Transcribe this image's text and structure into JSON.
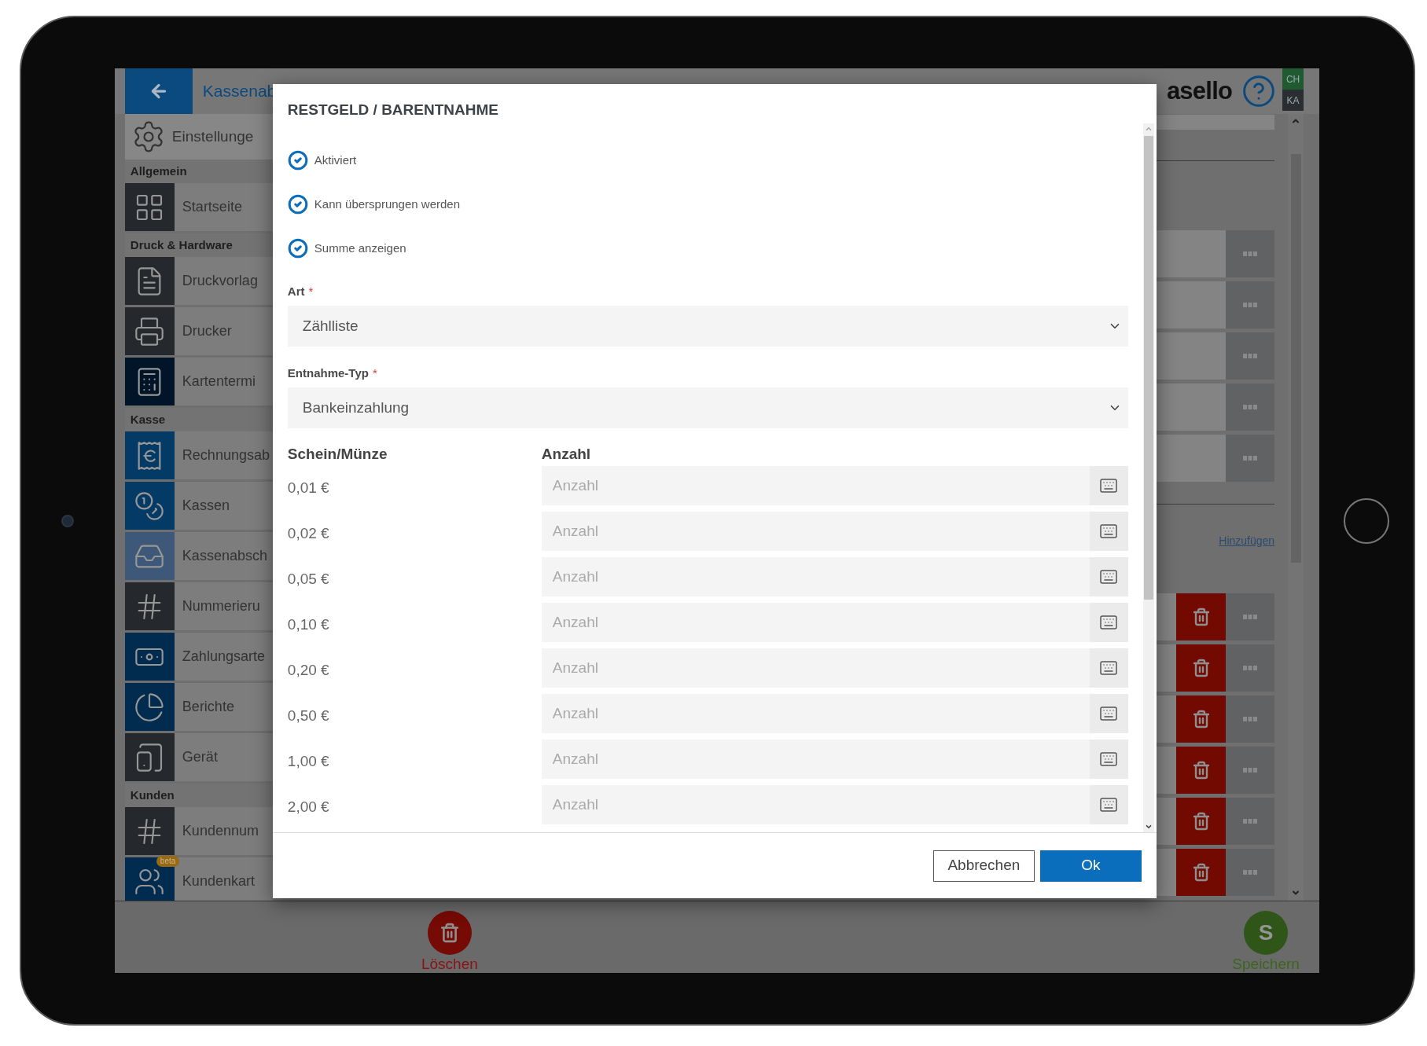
{
  "header": {
    "title": "Kassenab",
    "logo": "asello",
    "badges": [
      {
        "label": "CH",
        "color": "#1f5a30"
      },
      {
        "label": "KA",
        "color": "#2a2d31"
      }
    ]
  },
  "sidebar": {
    "header": "Einstellunge",
    "sections": [
      {
        "title": "Allgemein",
        "items": [
          {
            "label": "Startseite",
            "color": "#25282c"
          }
        ]
      },
      {
        "title": "Druck & Hardware",
        "items": [
          {
            "label": "Druckvorlag",
            "color": "#25282c"
          },
          {
            "label": "Drucker",
            "color": "#25282c"
          },
          {
            "label": "Kartentermi",
            "color": "#011528"
          }
        ]
      },
      {
        "title": "Kasse",
        "items": [
          {
            "label": "Rechnungsab",
            "color": "#033a66"
          },
          {
            "label": "Kassen",
            "color": "#033a66"
          },
          {
            "label": "Kassenabsch",
            "color": "#3d5878"
          },
          {
            "label": "Nummerieru",
            "color": "#25282c"
          },
          {
            "label": "Zahlungsarte",
            "color": "#022b50"
          },
          {
            "label": "Berichte",
            "color": "#022b50"
          },
          {
            "label": "Gerät",
            "color": "#25282c"
          }
        ]
      },
      {
        "title": "Kunden",
        "items": [
          {
            "label": "Kundennum",
            "color": "#25282c"
          },
          {
            "label": "Kundenkart",
            "color": "#022b50",
            "badge": "beta"
          }
        ]
      }
    ]
  },
  "main": {
    "rows_top": [
      {
        "kind": "more"
      },
      {
        "kind": "more"
      },
      {
        "kind": "more"
      },
      {
        "kind": "more"
      },
      {
        "kind": "more"
      }
    ],
    "add_link": "Hinzufügen",
    "rows_bottom": [
      {
        "kind": "delete-more"
      },
      {
        "kind": "delete-more"
      },
      {
        "kind": "delete-more"
      },
      {
        "kind": "delete-more"
      },
      {
        "kind": "delete-more"
      },
      {
        "kind": "delete-more"
      }
    ]
  },
  "bottom_bar": {
    "delete_label": "Löschen",
    "save_letter": "S",
    "save_label": "Speichern"
  },
  "dialog": {
    "title": "RESTGELD / BARENTNAHME",
    "options": [
      {
        "label": "Aktiviert",
        "checked": true
      },
      {
        "label": "Kann übersprungen werden",
        "checked": true
      },
      {
        "label": "Summe anzeigen",
        "checked": true
      }
    ],
    "fields": [
      {
        "label": "Art",
        "marker": "*",
        "value": "Zählliste"
      },
      {
        "label": "Entnahme-Typ",
        "marker": "*",
        "value": "Bankeinzahlung"
      }
    ],
    "columns": [
      "Schein/Münze",
      "Anzahl"
    ],
    "rows": [
      {
        "denomination": "0,01 €",
        "placeholder": "Anzahl"
      },
      {
        "denomination": "0,02 €",
        "placeholder": "Anzahl"
      },
      {
        "denomination": "0,05 €",
        "placeholder": "Anzahl"
      },
      {
        "denomination": "0,10 €",
        "placeholder": "Anzahl"
      },
      {
        "denomination": "0,20 €",
        "placeholder": "Anzahl"
      },
      {
        "denomination": "0,50 €",
        "placeholder": "Anzahl"
      },
      {
        "denomination": "1,00 €",
        "placeholder": "Anzahl"
      },
      {
        "denomination": "2,00 €",
        "placeholder": "Anzahl"
      }
    ],
    "buttons": [
      {
        "label": "Abbrechen",
        "kind": "secondary"
      },
      {
        "label": "Ok",
        "kind": "primary"
      }
    ]
  }
}
